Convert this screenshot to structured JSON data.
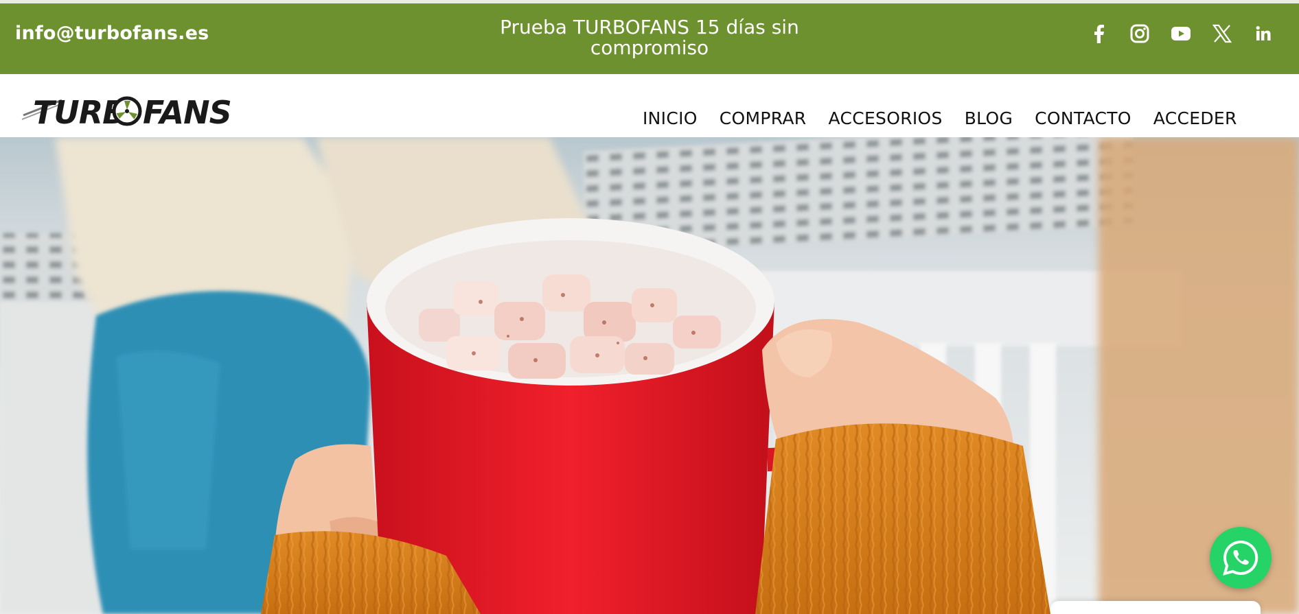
{
  "topbar": {
    "email": "info@turbofans.es",
    "promo": "Prueba TURBOFANS 15 días sin compromiso",
    "bg_color": "#6e9130",
    "social": [
      "facebook-icon",
      "instagram-icon",
      "youtube-icon",
      "x-icon",
      "linkedin-icon"
    ]
  },
  "header": {
    "logo_text": "TURBOFANS",
    "nav": [
      "INICIO",
      "COMPRAR",
      "ACCESORIOS",
      "BLOG",
      "CONTACTO",
      "ACCEDER"
    ]
  },
  "hero": {
    "image": "hands-holding-red-mug-with-marshmallows-near-radiator"
  },
  "whatsapp": {
    "icon": "whatsapp-icon",
    "color": "#25d366"
  }
}
